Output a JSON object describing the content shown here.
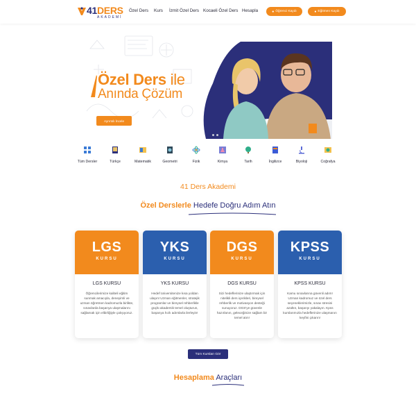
{
  "logo": {
    "number": "41",
    "word": "DERS",
    "sub": "AKADEMİ"
  },
  "nav": {
    "items": [
      "Özel Ders",
      "Kurs",
      "İzmit Özel Ders",
      "Kocaeli Özel Ders",
      "Hesapla"
    ],
    "student_button": "Öğrenci Kaydı",
    "teacher_button": "Eğitmen Kaydı"
  },
  "hero": {
    "title_bold": "Özel Ders",
    "title_rest": " ile",
    "title_line2": "Anında Çözüm",
    "cta": "Ayrıntılı İncele"
  },
  "subjects": [
    "Tüm Dersler",
    "Türkçe",
    "Matematik",
    "Geometri",
    "Fizik",
    "Kimya",
    "Tarih",
    "İngilizce",
    "Biyoloji",
    "Coğrafya"
  ],
  "section": {
    "title": "41 Ders Akademi",
    "subtitle_orange": "Özel Derslerle",
    "subtitle_navy": "Hedefe Doğru Adım Atın"
  },
  "courses": [
    {
      "code": "LGS",
      "kurs": "KURSU",
      "name": "LGS KURSU",
      "color": "#f28a1d",
      "desc": "Öğrencilerimize kaliteli eğitim sunmak amacıyla, deneyimli ve uzman öğretmen kadromuzla birlikte, sınavlarda başarıya ulaşmalarını sağlamak için elbirliğiyle çalışıyoruz."
    },
    {
      "code": "YKS",
      "kurs": "KURSU",
      "name": "YKS KURSU",
      "color": "#2b5fae",
      "desc": "Hedef üniversitenize kısa yoldan ulaşın! Uzman eğitmenler, stratejik programlar ve bireysel rehberlikle güçlü akademik temel oluşturun, başarıya hızlı adımlarla ilerleyin!"
    },
    {
      "code": "DGS",
      "kurs": "KURSU",
      "name": "DGS KURSU",
      "color": "#f28a1d",
      "desc": "Sizi hedeflerinize ulaştırmak için nitelikli ders içerikleri, bireysel rehberlik ve motivasyon desteği sunuyoruz. DGS'ye güvenle hazırlanın, geleceğinize sağlam bir temel atın!"
    },
    {
      "code": "KPSS",
      "kurs": "KURSU",
      "name": "KPSS KURSU",
      "color": "#2b5fae",
      "desc": "Kamu sınavlarına güvenli adım! Uzman kadromuz ve özel ders seçeneklerimizle, sınav stresini azaltın, başarıyı yakalayın. Kpss kurslarımızla hedeflerinize ulaşmanın keyfini çıkarın!"
    }
  ],
  "all_courses_button": "Tüm Kursları Gör",
  "calc": {
    "orange": "Hesaplama",
    "navy": "Araçları"
  },
  "colors": {
    "orange": "#f28a1d",
    "navy": "#2b2f7a",
    "blue": "#2b5fae"
  }
}
